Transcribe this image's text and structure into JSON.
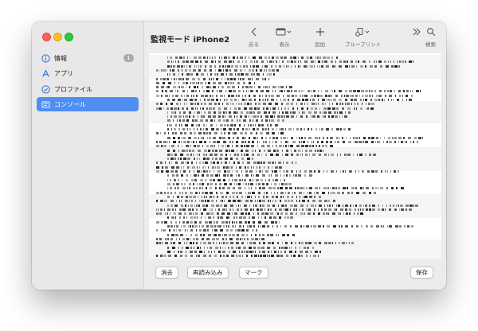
{
  "window": {
    "title": "監視モード iPhone2"
  },
  "sidebar": {
    "items": [
      {
        "label": "情報",
        "icon": "info-icon",
        "badge": "1",
        "selected": false
      },
      {
        "label": "アプリ",
        "icon": "app-store-icon",
        "selected": false
      },
      {
        "label": "プロファイル",
        "icon": "profile-icon",
        "selected": false
      },
      {
        "label": "コンソール",
        "icon": "console-icon",
        "selected": true
      }
    ]
  },
  "toolbar": {
    "back_label": "戻る",
    "view_label": "表示",
    "add_label": "追加",
    "blueprint_label": "ブループリント",
    "search_label": "検索"
  },
  "bottom_bar": {
    "clear_label": "消去",
    "reload_label": "再読み込み",
    "mark_label": "マーク",
    "save_label": "保存"
  },
  "colors": {
    "accent": "#4f8ef3",
    "sidebar_bg": "#e8e8e8",
    "toolbar_bg": "#ececec",
    "console_band": "#f5f5f5"
  }
}
